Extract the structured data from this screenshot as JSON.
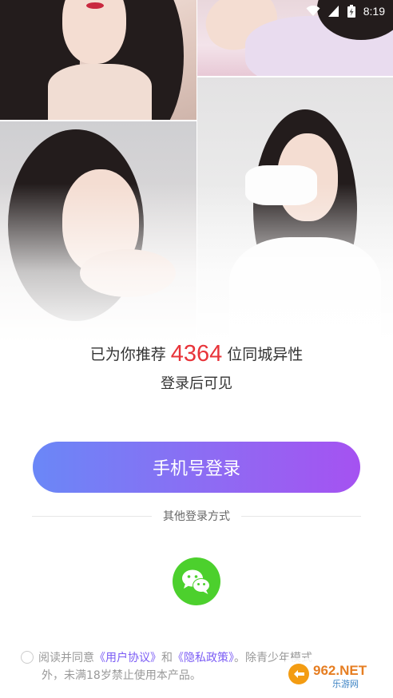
{
  "status_bar": {
    "time": "8:19",
    "icons": [
      "wifi-icon",
      "signal-icon",
      "battery-charging-icon"
    ]
  },
  "collage": {
    "photos": [
      "portrait-photo-1",
      "portrait-photo-2",
      "portrait-photo-3",
      "portrait-photo-4"
    ]
  },
  "recommendation": {
    "prefix": "已为你推荐",
    "count": "4364",
    "suffix": "位同城异性",
    "subtitle": "登录后可见"
  },
  "login": {
    "phone_button_label": "手机号登录",
    "other_methods_label": "其他登录方式",
    "wechat_icon": "wechat-icon"
  },
  "agreement": {
    "prefix": "阅读并同意",
    "user_agreement_link": "《用户协议》",
    "and": "和",
    "privacy_link": "《隐私政策》",
    "line1_tail": "。除青少年模式",
    "line2": "外，未满18岁禁止使用本产品。"
  },
  "watermark": {
    "text": "962.NET",
    "subtext": "乐游网"
  },
  "colors": {
    "accent_red": "#e8343a",
    "button_gradient_start": "#6a87f7",
    "button_gradient_end": "#a552f1",
    "wechat_green": "#4cd02d",
    "link_purple": "#7b5cf5"
  }
}
